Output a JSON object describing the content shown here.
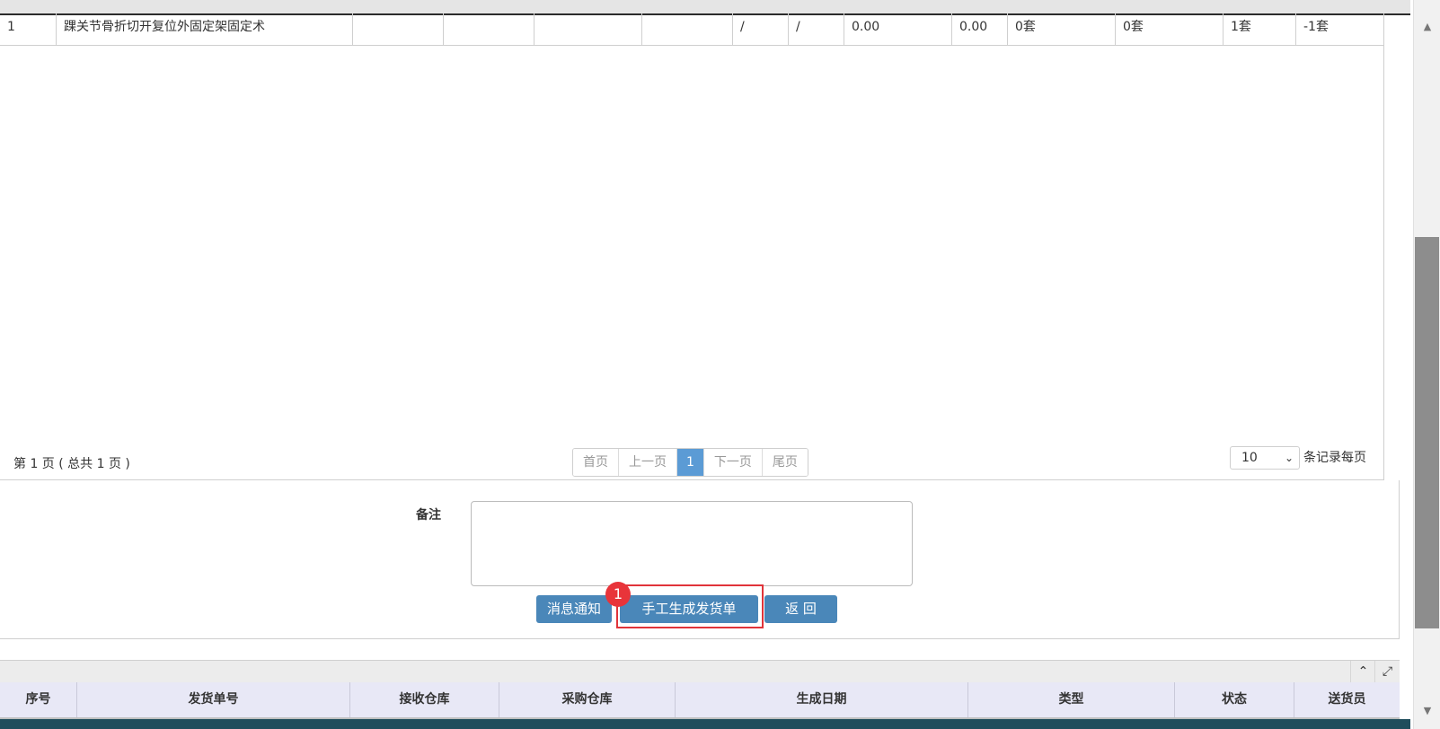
{
  "table_row": {
    "index": "1",
    "name": "踝关节骨折切开复位外固定架固定术",
    "col_slash_1": "/",
    "col_slash_2": "/",
    "amount_1": "0.00",
    "amount_2": "0.00",
    "qty_1": "0套",
    "qty_2": "0套",
    "qty_3": "1套",
    "qty_4": "-1套"
  },
  "pager": {
    "page_info": "第 1 页 ( 总共 1 页 )",
    "first": "首页",
    "prev": "上一页",
    "current": "1",
    "next": "下一页",
    "last": "尾页",
    "per_page_value": "10",
    "per_page_label": "条记录每页"
  },
  "form": {
    "remark_label": "备注",
    "remark_value": ""
  },
  "buttons": {
    "notify": "消息通知",
    "manual_generate": "手工生成发货单",
    "back": "返 回"
  },
  "annotation": {
    "badge_number": "1",
    "highlight_color": "#e0343a"
  },
  "grid2": {
    "headers": [
      "序号",
      "发货单号",
      "接收仓库",
      "采购仓库",
      "生成日期",
      "类型",
      "状态",
      "送货员"
    ]
  },
  "icons": {
    "collapse": "chevron-up-icon",
    "expand": "expand-icon"
  },
  "colors": {
    "button": "#4a87b9",
    "pager_active": "#5b9bd5",
    "grid_header": "#e8e8f6"
  }
}
